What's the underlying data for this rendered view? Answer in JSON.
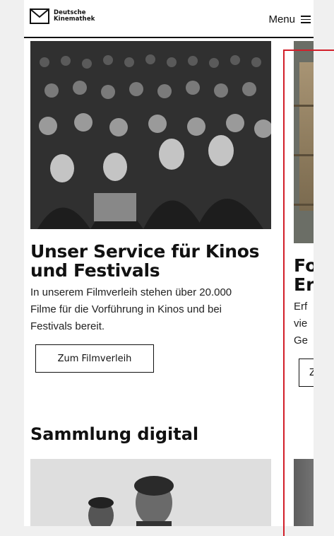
{
  "header": {
    "logo_line1": "Deutsche",
    "logo_line2": "Kinemathek",
    "menu_label": "Menu"
  },
  "cards": [
    {
      "title": "Unser Service für Kinos und Festivals",
      "text": "In unserem Filmverleih stehen über 20.000 Filme für die Vorführung in Kinos und bei Festivals bereit.",
      "button_label": "Zum Filmverleih",
      "image": "black-and-white photo of a laughing cinema audience"
    },
    {
      "title_line1": "Fo",
      "title_line2": "Er",
      "text_line1": "Erf",
      "text_line2": "vie",
      "text_line3": "Ge",
      "button_label": "Z",
      "image": "archive boxes on shelves"
    }
  ],
  "sections": {
    "digital_heading": "Sammlung digital"
  },
  "colors": {
    "guide_line": "#d21f2a",
    "text": "#111111",
    "background": "#ffffff"
  }
}
